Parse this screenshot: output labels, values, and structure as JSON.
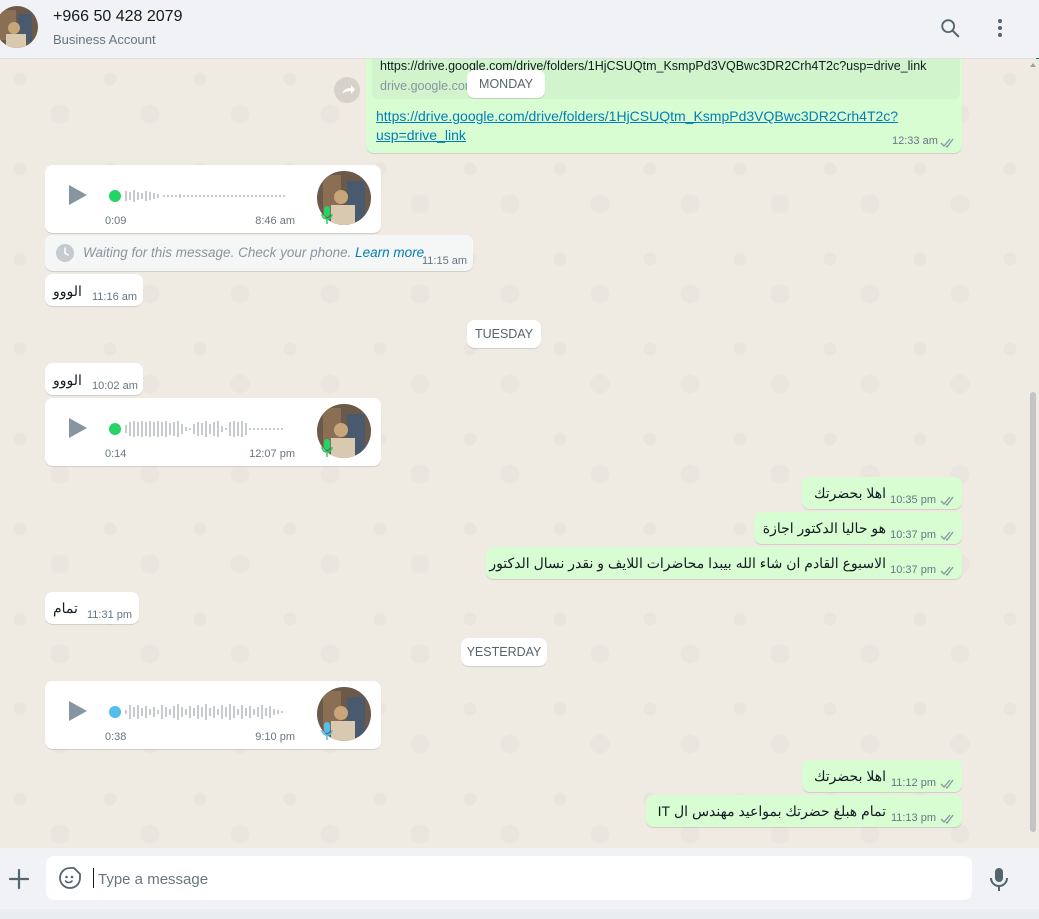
{
  "header": {
    "title": "+966 50 428 2079",
    "subtitle": "Business Account",
    "search_icon": "search-icon",
    "menu_icon": "kebab-menu-icon"
  },
  "colors": {
    "incoming_bubble": "#ffffff",
    "outgoing_bubble": "#d9fdd3",
    "chat_background": "#efeae2",
    "read_ticks": "#8696a0",
    "link": "#027eb5",
    "voice_dot_unplayed": "#25d366",
    "voice_dot_played": "#53bdeb"
  },
  "link_preview": {
    "url_text": "https://drive.google.com/drive/folders/1HjCSUQtm_KsmpPd3VQBwc3DR2Crh4T2c?usp=drive_link",
    "domain": "drive.google.com"
  },
  "link_message": {
    "line1": "https://drive.google.com/drive/folders/1HjCSUQtm_KsmpPd3VQBwc3DR2Crh4T2c?",
    "line2": "usp=drive_link",
    "time": "12:33 am"
  },
  "dates": {
    "monday": "MONDAY",
    "tuesday": "TUESDAY",
    "yesterday": "YESTERDAY"
  },
  "voice_notes": [
    {
      "duration": "0:09",
      "time": "8:46 am"
    },
    {
      "duration": "0:14",
      "time": "12:07 pm"
    },
    {
      "duration": "0:38",
      "time": "9:10 pm"
    }
  ],
  "waiting_message": {
    "text": "Waiting for this message. Check your phone.",
    "link": "Learn more",
    "time": "11:15 am"
  },
  "incoming_texts": [
    {
      "text": "الووو",
      "time": "11:16 am"
    },
    {
      "text": "الووو",
      "time": "10:02 am"
    },
    {
      "text": "تمام",
      "time": "11:31 pm"
    }
  ],
  "outgoing_texts": [
    {
      "text": "اهلا بحضرتك",
      "time": "10:35 pm"
    },
    {
      "text": "هو حاليا الدكتور اجازة",
      "time": "10:37 pm"
    },
    {
      "text": "الاسبوع القادم ان شاء الله بيبدا محاضرات اللايف و نقدر نسال الدكتور",
      "time": "10:37 pm"
    },
    {
      "text": "اهلا بحضرتك",
      "time": "11:12 pm"
    },
    {
      "text": "تمام هبلغ حضرتك بمواعيد مهندس ال IT",
      "time": "11:13 pm"
    }
  ],
  "composer": {
    "placeholder": "Type a message",
    "attach_icon": "plus-icon",
    "emoji_icon": "sticker-icon",
    "voice_icon": "microphone-icon"
  }
}
